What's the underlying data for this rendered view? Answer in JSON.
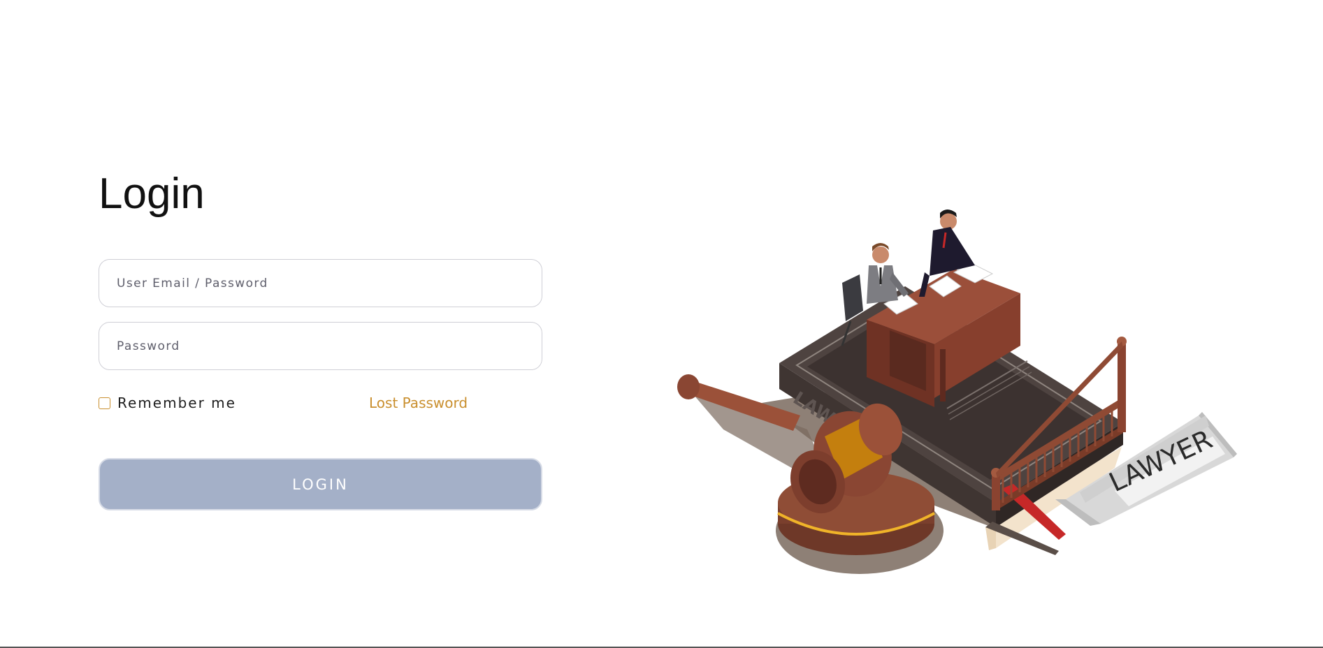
{
  "login": {
    "title": "Login",
    "email_placeholder": "User Email / Password",
    "password_placeholder": "Password",
    "remember_label": "Remember me",
    "remember_checked": false,
    "lost_password_label": "Lost Password",
    "submit_label": "LOGIN"
  },
  "illustration": {
    "book_cover_text": "LAW",
    "book_spine_text": "LAW",
    "sign_text": "LAWYER"
  },
  "colors": {
    "accent": "#c98f2e",
    "button_bg": "#a4b0c8",
    "text": "#111111",
    "border": "#cfcfd6"
  }
}
